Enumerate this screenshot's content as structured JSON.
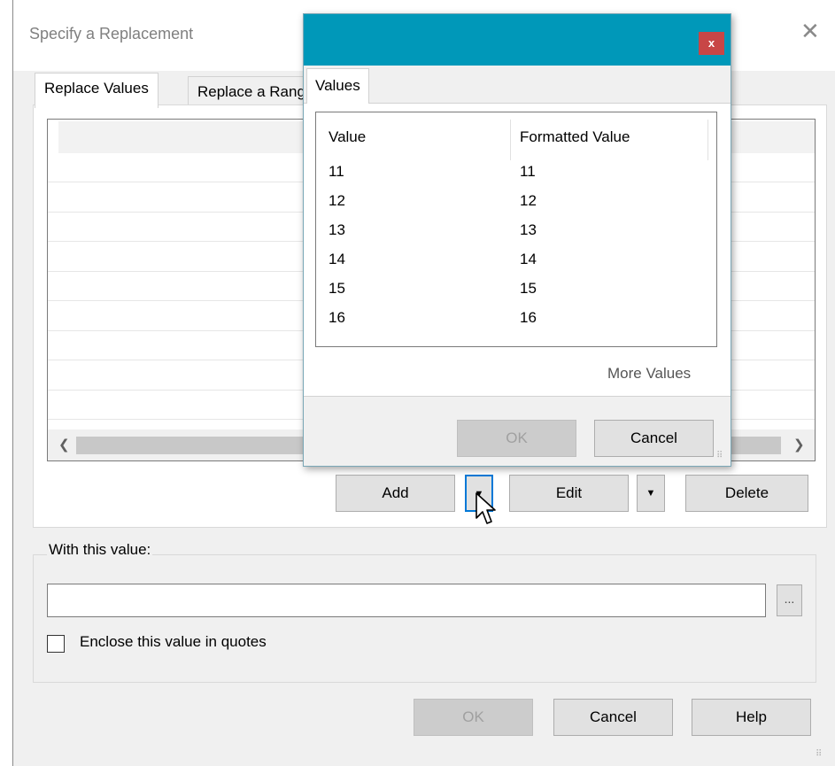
{
  "dialog": {
    "title": "Specify a Replacement",
    "tabs": [
      {
        "label": "Replace Values"
      },
      {
        "label": "Replace a Range"
      }
    ],
    "buttons": {
      "add": "Add",
      "edit": "Edit",
      "delete": "Delete",
      "ok": "OK",
      "cancel": "Cancel",
      "help": "Help"
    },
    "with_value": {
      "group_label": "With this value:",
      "input_value": "",
      "browse_label": "...",
      "checkbox_label": "Enclose this value in quotes",
      "checkbox_checked": false
    }
  },
  "popup": {
    "tab": "Values",
    "columns": [
      "Value",
      "Formatted Value"
    ],
    "rows": [
      {
        "value": "11",
        "formatted": "11"
      },
      {
        "value": "12",
        "formatted": "12"
      },
      {
        "value": "13",
        "formatted": "13"
      },
      {
        "value": "14",
        "formatted": "14"
      },
      {
        "value": "15",
        "formatted": "15"
      },
      {
        "value": "16",
        "formatted": "16"
      }
    ],
    "more_values": "More Values",
    "ok": "OK",
    "cancel": "Cancel",
    "close_glyph": "x"
  },
  "icons": {
    "close": "close-icon",
    "dropdown": "chevron-down-icon",
    "scroll_left": "arrow-left-icon",
    "scroll_right": "arrow-right-icon",
    "cursor": "mouse-pointer-icon"
  },
  "colors": {
    "popup_title": "#0098b9",
    "popup_close": "#c84646",
    "focus": "#0078d7"
  }
}
